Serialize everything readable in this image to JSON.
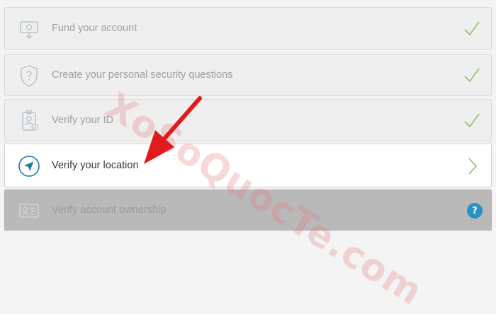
{
  "steps": [
    {
      "label": "Fund your account",
      "icon": "money-icon",
      "status": "completed"
    },
    {
      "label": "Create your personal security questions",
      "icon": "shield-question-icon",
      "status": "completed"
    },
    {
      "label": "Verify your ID",
      "icon": "id-badge-icon",
      "status": "completed"
    },
    {
      "label": "Verify your location",
      "icon": "location-arrow-icon",
      "status": "current"
    },
    {
      "label": "Verify account ownership",
      "icon": "id-card-icon",
      "status": "locked"
    }
  ],
  "help": {
    "label": "?"
  },
  "watermark": {
    "text": "XoSoQuocTe.com"
  },
  "colors": {
    "check": "#8dc06a",
    "accent": "#1e7aa8",
    "help": "#2a8fc4",
    "arrow": "#e11b1b"
  }
}
